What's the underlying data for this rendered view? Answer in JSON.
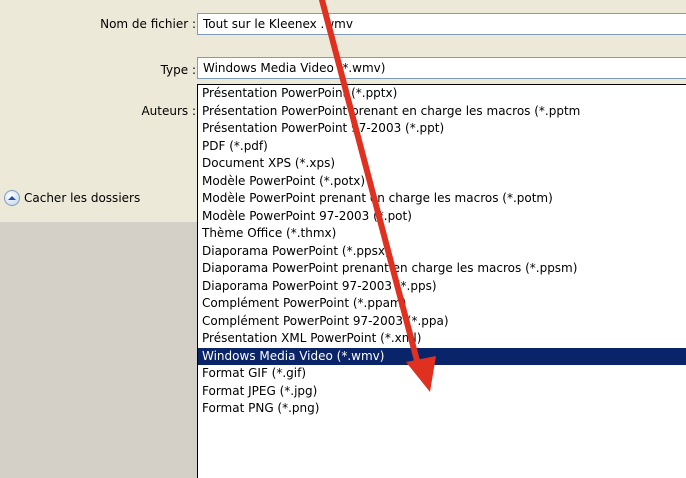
{
  "fields": {
    "filename_label": "Nom de fichier :",
    "filename_value": "Tout sur le Kleenex .wmv",
    "type_label": "Type :",
    "type_value": "Windows Media Video (*.wmv)",
    "authors_label": "Auteurs :"
  },
  "hide_folders": {
    "label": "Cacher les dossiers",
    "icon": "chevron-up-icon"
  },
  "type_options": [
    "Présentation PowerPoint (*.pptx)",
    "Présentation PowerPoint prenant en charge les macros (*.pptm",
    "Présentation PowerPoint 97-2003 (*.ppt)",
    "PDF (*.pdf)",
    "Document XPS (*.xps)",
    "Modèle PowerPoint (*.potx)",
    "Modèle PowerPoint prenant en charge les macros (*.potm)",
    "Modèle PowerPoint 97-2003 (*.pot)",
    "Thème Office (*.thmx)",
    "Diaporama PowerPoint (*.ppsx)",
    "Diaporama PowerPoint prenant en charge les macros (*.ppsm)",
    "Diaporama PowerPoint 97-2003 (*.pps)",
    "Complément PowerPoint (*.ppam)",
    "Complément PowerPoint 97-2003 (*.ppa)",
    "Présentation XML PowerPoint (*.xml)",
    "Windows Media Video (*.wmv)",
    "Format GIF (*.gif)",
    "Format JPEG (*.jpg)",
    "Format PNG (*.png)"
  ],
  "selected_index": 15,
  "colors": {
    "selection": "#0a246a",
    "arrow": "#e03020"
  }
}
